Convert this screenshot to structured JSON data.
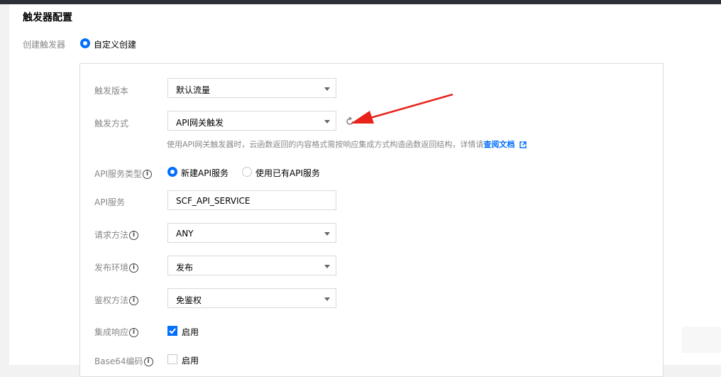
{
  "section": {
    "title": "触发器配置"
  },
  "create_trigger": {
    "label": "创建触发器",
    "option": "自定义创建"
  },
  "fields": {
    "version": {
      "label": "触发版本",
      "value": "默认流量"
    },
    "method": {
      "label": "触发方式",
      "value": "API网关触发"
    },
    "hint": {
      "text": "使用API网关触发器时，云函数返回的内容格式需按响应集成方式构造函数返回结构，详情请",
      "link": "查阅文档"
    },
    "service_type": {
      "label": "API服务类型",
      "option_new": "新建API服务",
      "option_existing": "使用已有API服务"
    },
    "service": {
      "label": "API服务",
      "value": "SCF_API_SERVICE"
    },
    "request_method": {
      "label": "请求方法",
      "value": "ANY"
    },
    "env": {
      "label": "发布环境",
      "value": "发布"
    },
    "auth": {
      "label": "鉴权方法",
      "value": "免鉴权"
    },
    "integration": {
      "label": "集成响应",
      "checkbox_label": "启用"
    },
    "base64": {
      "label": "Base64编码",
      "checkbox_label": "启用"
    }
  },
  "icons": {
    "help": "i"
  },
  "colors": {
    "accent": "#006eff",
    "annotation_arrow": "#e8231c"
  }
}
